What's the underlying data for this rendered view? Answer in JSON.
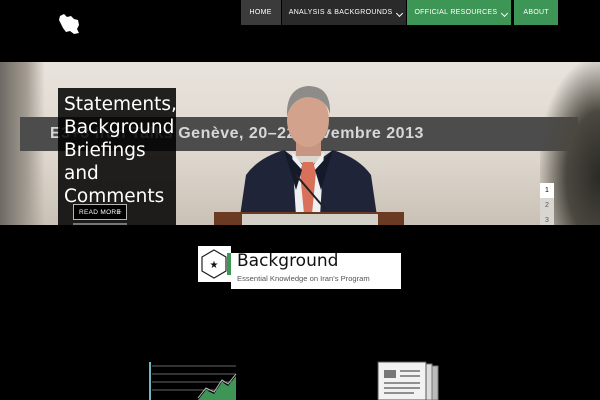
{
  "nav": {
    "items": [
      {
        "label": "Home"
      },
      {
        "label": "Analysis & Backgrounds"
      },
      {
        "label": "Official Resources"
      },
      {
        "label": "About"
      }
    ]
  },
  "hero": {
    "banner_text": "E3+3 Iran Talks     Genève, 20–22 novembre 2013",
    "caption_title": "Statements, Background Briefings and Comments",
    "read_more": "READ MORE",
    "pager": [
      "1",
      "2",
      "3"
    ]
  },
  "background_promo": {
    "title": "Background",
    "subtitle": "Essential Knowledge on Iran's Program"
  },
  "colors": {
    "accent_green": "#3e9656",
    "nav_dark": "#3b3b3b",
    "background": "#000000"
  }
}
